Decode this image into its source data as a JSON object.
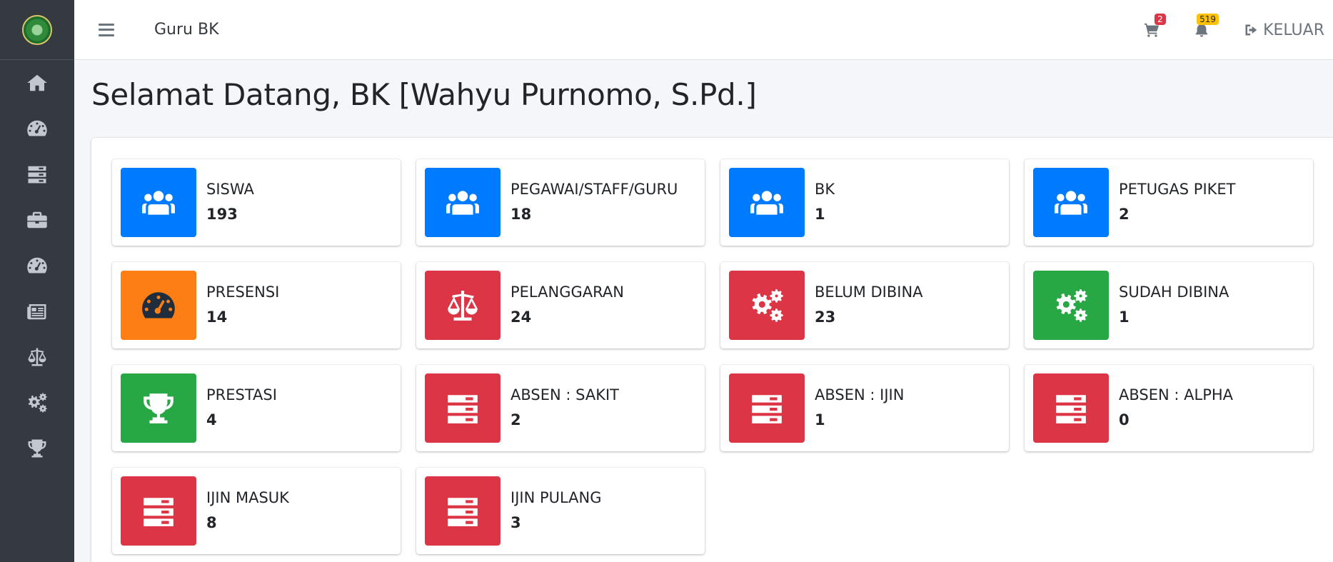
{
  "sidebar": {
    "items": [
      {
        "icon": "home-icon"
      },
      {
        "icon": "tachometer-icon"
      },
      {
        "icon": "server-icon"
      },
      {
        "icon": "briefcase-icon"
      },
      {
        "icon": "tachometer-icon"
      },
      {
        "icon": "newspaper-icon"
      },
      {
        "icon": "balance-scale-icon"
      },
      {
        "icon": "cogs-icon"
      },
      {
        "icon": "trophy-icon"
      }
    ]
  },
  "topbar": {
    "title": "Guru BK",
    "cart_badge": "2",
    "bell_badge": "519",
    "logout_label": "KELUAR"
  },
  "page": {
    "title": "Selamat Datang, BK [Wahyu Purnomo, S.Pd.]"
  },
  "cards": [
    {
      "label": "SISWA",
      "value": "193",
      "color": "#007bff",
      "icon": "users-icon"
    },
    {
      "label": "PEGAWAI/STAFF/GURU",
      "value": "18",
      "color": "#007bff",
      "icon": "users-icon"
    },
    {
      "label": "BK",
      "value": "1",
      "color": "#007bff",
      "icon": "users-icon"
    },
    {
      "label": "PETUGAS PIKET",
      "value": "2",
      "color": "#007bff",
      "icon": "users-icon"
    },
    {
      "label": "PRESENSI",
      "value": "14",
      "color": "#fd7e14",
      "icon": "tachometer-icon"
    },
    {
      "label": "PELANGGARAN",
      "value": "24",
      "color": "#dc3545",
      "icon": "balance-scale-icon"
    },
    {
      "label": "BELUM DIBINA",
      "value": "23",
      "color": "#dc3545",
      "icon": "cogs-icon"
    },
    {
      "label": "SUDAH DIBINA",
      "value": "1",
      "color": "#28a745",
      "icon": "cogs-icon"
    },
    {
      "label": "PRESTASI",
      "value": "4",
      "color": "#28a745",
      "icon": "trophy-icon"
    },
    {
      "label": "ABSEN : SAKIT",
      "value": "2",
      "color": "#dc3545",
      "icon": "server-icon"
    },
    {
      "label": "ABSEN : IJIN",
      "value": "1",
      "color": "#dc3545",
      "icon": "server-icon"
    },
    {
      "label": "ABSEN : ALPHA",
      "value": "0",
      "color": "#dc3545",
      "icon": "server-icon"
    },
    {
      "label": "IJIN MASUK",
      "value": "8",
      "color": "#dc3545",
      "icon": "server-icon"
    },
    {
      "label": "IJIN PULANG",
      "value": "3",
      "color": "#dc3545",
      "icon": "server-icon"
    }
  ]
}
